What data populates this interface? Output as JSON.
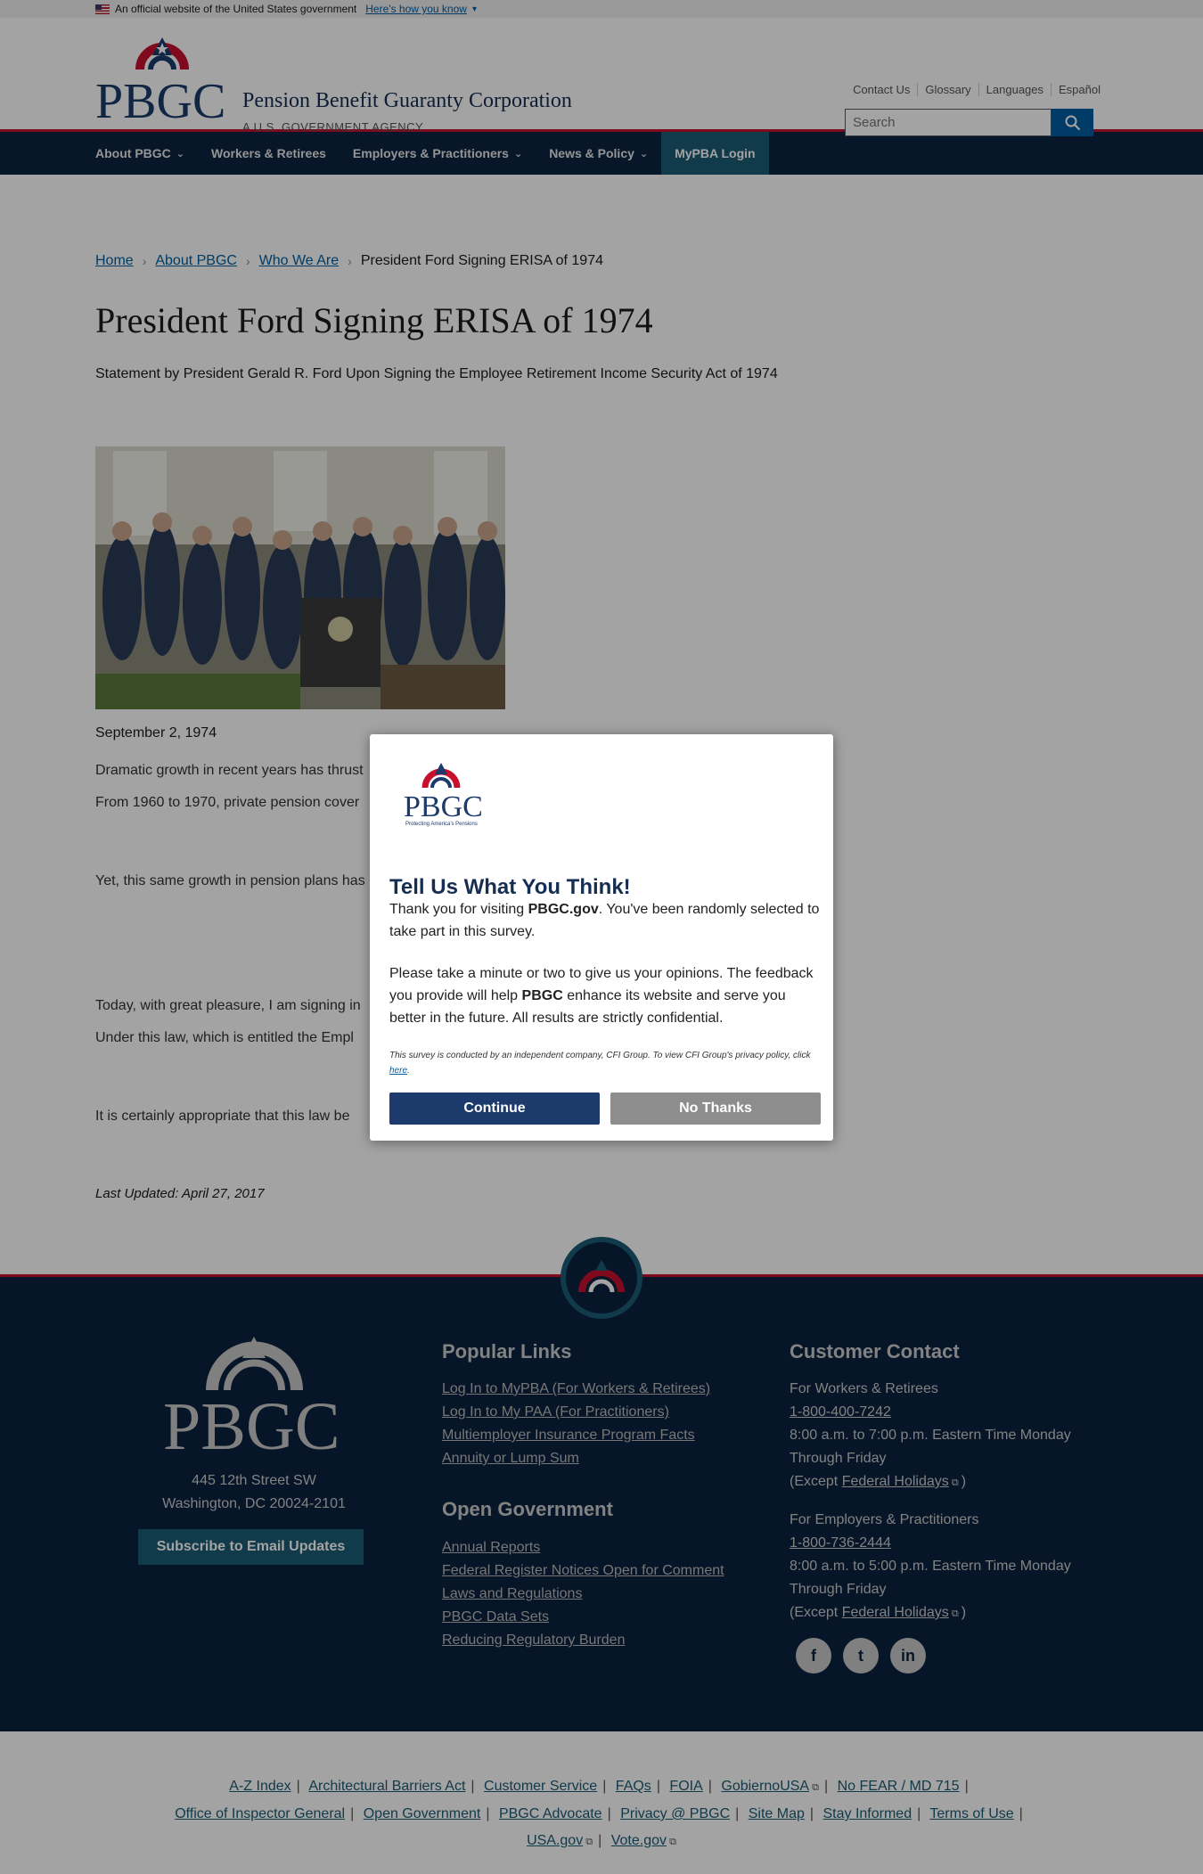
{
  "gov_banner": {
    "text": "An official website of the United States government",
    "link": "Here's how you know"
  },
  "header": {
    "agency_name": "Pension Benefit Guaranty Corporation",
    "agency_sub": "A U.S. GOVERNMENT AGENCY",
    "util_links": [
      "Contact Us",
      "Glossary",
      "Languages",
      "Español"
    ],
    "search_placeholder": "Search"
  },
  "nav": {
    "items": [
      {
        "label": "About PBGC",
        "dropdown": true
      },
      {
        "label": "Workers & Retirees",
        "dropdown": false
      },
      {
        "label": "Employers & Practitioners",
        "dropdown": true
      },
      {
        "label": "News & Policy",
        "dropdown": true
      }
    ],
    "login": "MyPBA Login"
  },
  "breadcrumb": [
    "Home",
    "About PBGC",
    "Who We Are",
    "President Ford Signing ERISA of 1974"
  ],
  "page": {
    "title": "President Ford Signing ERISA of 1974",
    "lead": "Statement by President Gerald R. Ford Upon Signing the Employee Retirement Income Security Act of 1974",
    "date": "September 2, 1974",
    "paragraphs": [
      "Dramatic growth in recent years has thrust",
      "From 1960 to 1970, private pension cover",
      "Yet, this same growth in pension plans has",
      "Today, with great pleasure, I am signing in",
      "Under this law, which is entitled the Empl",
      "It is certainly appropriate that this law be"
    ],
    "updated": "Last Updated: April 27, 2017"
  },
  "footer": {
    "address_1": "445 12th Street SW",
    "address_2": "Washington, DC 20024-2101",
    "subscribe": "Subscribe to Email Updates",
    "popular_title": "Popular Links",
    "popular": [
      "Log In to MyPBA (For Workers & Retirees)",
      "Log In to My PAA (For Practitioners)",
      "Multiemployer Insurance Program Facts",
      "Annuity or Lump Sum"
    ],
    "open_title": "Open Government",
    "open": [
      "Annual Reports",
      "Federal Register Notices Open for Comment",
      "Laws and Regulations",
      "PBGC Data Sets",
      "Reducing Regulatory Burden"
    ],
    "contact_title": "Customer Contact",
    "contact_workers": "For Workers & Retirees",
    "phone_workers": "1-800-400-7242",
    "hours_workers": "8:00 a.m. to 7:00 p.m. Eastern Time Monday Through Friday",
    "except": "(Except",
    "holidays": "Federal Holidays",
    "close_paren": ")",
    "contact_employers": "For Employers & Practitioners",
    "phone_employers": "1-800-736-2444",
    "hours_employers": "8:00 a.m. to 5:00 p.m. Eastern Time Monday Through Friday",
    "bottom_links_1": [
      "A-Z Index",
      "Architectural Barriers Act",
      "Customer Service",
      "FAQs",
      "FOIA",
      "GobiernoUSA",
      "No FEAR / MD 715"
    ],
    "bottom_links_2": [
      "Office of Inspector General",
      "Open Government",
      "PBGC Advocate",
      "Privacy @ PBGC",
      "Site Map",
      "Stay Informed",
      "Terms of Use"
    ],
    "bottom_links_3": [
      "USA.gov",
      "Vote.gov"
    ]
  },
  "modal": {
    "logo_tagline": "Protecting America's Pensions",
    "title": "Tell Us What You Think!",
    "p1_a": "Thank you for visiting ",
    "p1_b": "PBGC.gov",
    "p1_c": ". You've been randomly selected to take part in this survey.",
    "p2_a": "Please take a minute or two to give us your opinions. The feedback you provide will help ",
    "p2_b": "PBGC",
    "p2_c": " enhance its website and serve you better in the future. All results are strictly confidential.",
    "small": "This survey is conducted by an independent company, CFI Group. To view CFI Group's privacy policy, click ",
    "small_link": "here",
    "continue": "Continue",
    "no_thanks": "No Thanks"
  },
  "colors": {
    "navy": "#0b2440",
    "red": "#c8102e",
    "teal": "#1b5c74",
    "link": "#005ea2"
  }
}
